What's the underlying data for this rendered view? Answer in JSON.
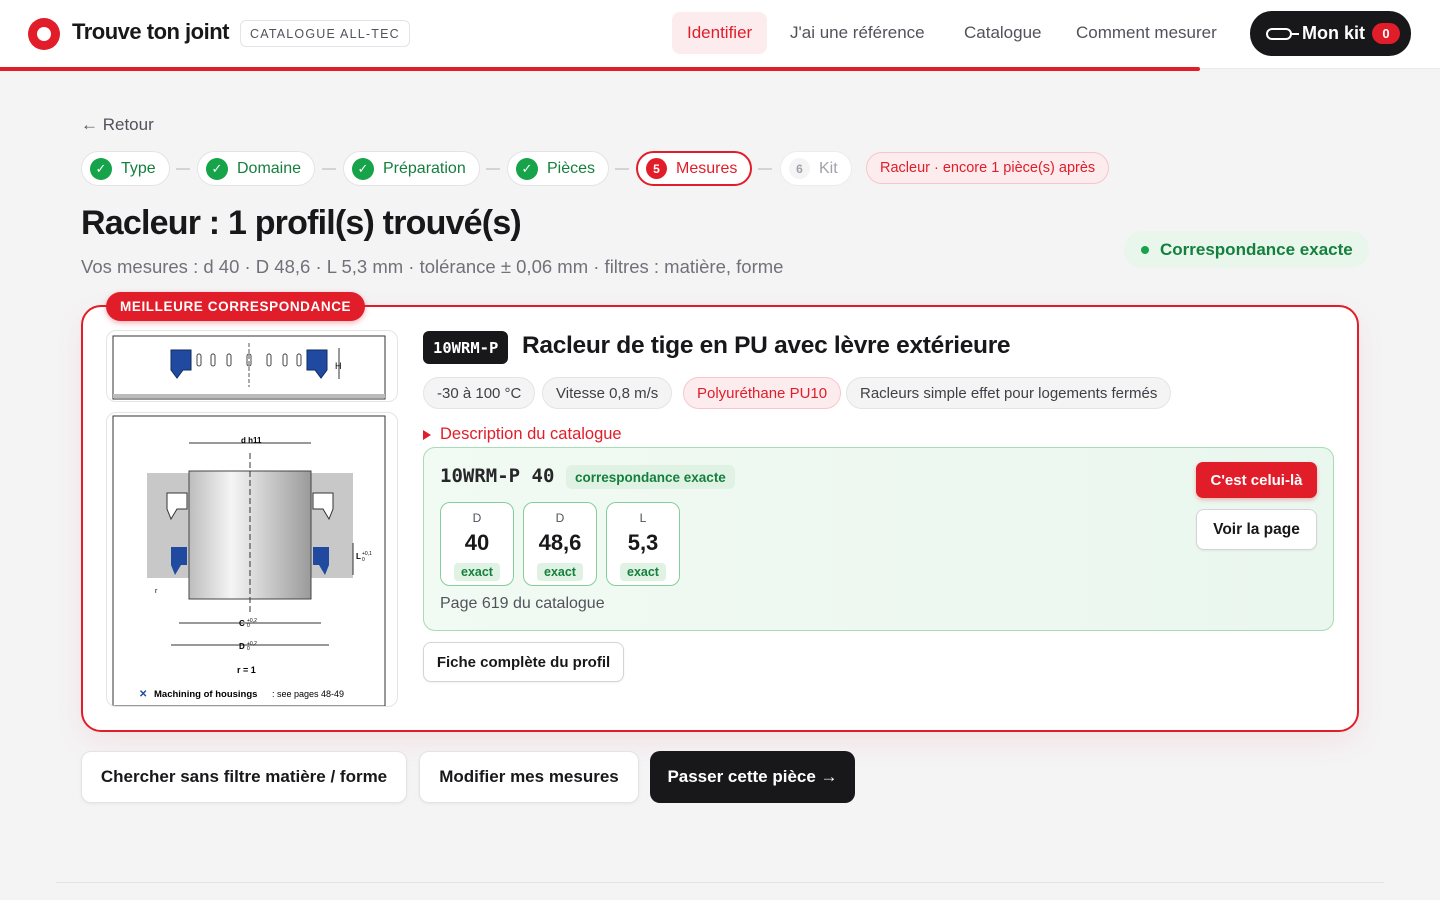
{
  "header": {
    "brand": "Trouve ton joint",
    "catalog_badge": "CATALOGUE ALL-TEC",
    "nav": [
      {
        "label": "Identifier",
        "active": true
      },
      {
        "label": "J'ai une référence",
        "active": false
      },
      {
        "label": "Catalogue",
        "active": false
      },
      {
        "label": "Comment mesurer",
        "active": false
      }
    ],
    "kit_label": "Mon kit",
    "kit_count": "0",
    "accent": "#e11d2a"
  },
  "back_label": "← Retour",
  "steps": [
    {
      "label": "Type",
      "state": "done",
      "icon": "check-icon"
    },
    {
      "label": "Domaine",
      "state": "done",
      "icon": "check-icon"
    },
    {
      "label": "Préparation",
      "state": "done",
      "icon": "check-icon"
    },
    {
      "label": "Pièces",
      "state": "done",
      "icon": "check-icon"
    },
    {
      "label": "Mesures",
      "state": "current",
      "number": "5"
    },
    {
      "label": "Kit",
      "state": "future",
      "number": "6"
    }
  ],
  "racleur_note": "Racleur · encore 1 pièce(s) après",
  "page_title": "Racleur : 1 profil(s) trouvé(s)",
  "page_subtitle": "Vos mesures : d 40 · D 48,6 · L 5,3 mm · tolérance ± 0,06 mm · filtres : matière, forme",
  "exact_label": "Correspondance exacte",
  "result": {
    "best_badge": "MEILLEURE CORRESPONDANCE",
    "reference": "10WRM-P",
    "title": "Racleur de tige en PU avec lèvre extérieure",
    "tags": [
      {
        "label": "-30 à 100 °C",
        "highlight": false
      },
      {
        "label": "Vitesse 0,8 m/s",
        "highlight": false
      },
      {
        "label": "Polyuréthane PU10",
        "highlight": true
      },
      {
        "label": "Racleurs simple effet pour logements fermés",
        "highlight": false
      }
    ],
    "description_toggle": "Description du catalogue",
    "drawing": {
      "label_d": "d h11",
      "label_h": "H",
      "label_l": "L",
      "label_l_tol_upper": "+0,1",
      "label_l_tol_lower": "0",
      "label_c": "C",
      "label_D": "D",
      "label_tol_upper": "+0,2",
      "label_tol_lower": "0",
      "label_r_small": "r",
      "label_r": "r = 1",
      "footnote_bold": "Machining of housings",
      "footnote_rest": ": see pages 48-49"
    },
    "match": {
      "code": "10WRM-P 40",
      "badge": "correspondance exacte",
      "dimensions": [
        {
          "label": "D",
          "value": "40",
          "status": "exact"
        },
        {
          "label": "D",
          "value": "48,6",
          "status": "exact"
        },
        {
          "label": "L",
          "value": "5,3",
          "status": "exact"
        }
      ],
      "page_ref": "Page 619 du catalogue",
      "select_label": "C'est celui-là",
      "view_label": "Voir la page"
    },
    "full_sheet_label": "Fiche complète du profil"
  },
  "actions": {
    "no_filter": "Chercher sans filtre matière / forme",
    "edit": "Modifier mes mesures",
    "skip": "Passer cette pièce →"
  }
}
